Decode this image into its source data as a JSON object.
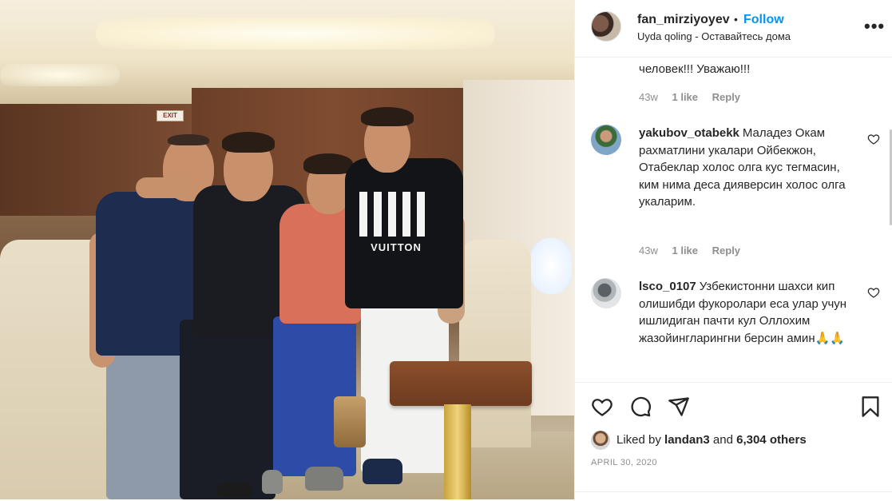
{
  "post": {
    "username": "fan_mirziyoyev",
    "follow_label": "Follow",
    "separator": "•",
    "location": "Uyda qoling - Оставайтесь дома",
    "more_label": "•••"
  },
  "comments": {
    "top_fragment": {
      "text": "человек!!! Уважаю!!!",
      "age": "43w",
      "likes": "1 like",
      "reply": "Reply"
    },
    "items": [
      {
        "username": "yakubov_otabekk",
        "text": "Маладез Окам рахматлини укалари Ойбекжон, Отабеклар холос олга кус тегмасин, ким нима деса дияверсин холос олга укаларим.",
        "age": "43w",
        "likes": "1 like",
        "reply": "Reply"
      },
      {
        "username": "lsco_0107",
        "text": "Узбекистонни шахси кип олишибди фукоролари еса улар учун ишлидиган пачти кул Оллохим жазойингларингни берсин амин🙏🙏"
      }
    ]
  },
  "actions": {
    "icons": [
      "heart-icon",
      "comment-icon",
      "share-icon",
      "bookmark-icon"
    ],
    "liked_by_prefix": "Liked by",
    "liked_by_user": "landan3",
    "liked_by_and": "and",
    "liked_by_count": "6,304 others",
    "date": "APRIL 30, 2020"
  },
  "photo": {
    "description_icon": "photo-of-four-men-in-aircraft-cabin",
    "sign_text": "EXIT",
    "shirt_text": "VUITTON"
  },
  "colors": {
    "accent": "#0095f6",
    "text": "#262626",
    "muted": "#8e8e8e",
    "border": "#efefef"
  }
}
